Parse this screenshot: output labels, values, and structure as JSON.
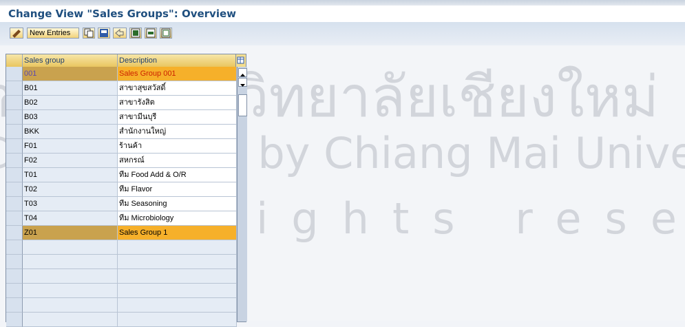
{
  "window": {
    "title": "Change View \"Sales Groups\": Overview"
  },
  "toolbar": {
    "new_entries_label": "New Entries",
    "icons": [
      "edit-icon",
      "copy-icon",
      "save-icon",
      "undo-icon",
      "select-all-icon",
      "select-block-icon",
      "deselect-all-icon"
    ]
  },
  "table": {
    "columns": [
      "Sales group",
      "Description"
    ],
    "rows": [
      {
        "group": "001",
        "description": "Sales Group 001"
      },
      {
        "group": "B01",
        "description": "สาขาสุขสวัสดิ์"
      },
      {
        "group": "B02",
        "description": "สาขารังสิต"
      },
      {
        "group": "B03",
        "description": "สาขามีนบุรี"
      },
      {
        "group": "BKK",
        "description": "สำนักงานใหญ่"
      },
      {
        "group": "F01",
        "description": "ร้านค้า"
      },
      {
        "group": "F02",
        "description": "สหกรณ์"
      },
      {
        "group": "T01",
        "description": "ทีม Food Add & O/R"
      },
      {
        "group": "T02",
        "description": "ทีม Flavor"
      },
      {
        "group": "T03",
        "description": "ทีม Seasoning"
      },
      {
        "group": "T04",
        "description": "ทีม Microbiology"
      },
      {
        "group": "Z01",
        "description": "Sales Group 1"
      }
    ]
  },
  "watermark": {
    "line1": "ลิขสิทธิ์มหาวิทยาลัยเชียงใหม่",
    "line2": "Copyright © by Chiang Mai University",
    "line3": "All rights reserved"
  },
  "colors": {
    "title": "#1f4f7f",
    "selected_row": "#f6b02a",
    "header": "#e9c660"
  }
}
